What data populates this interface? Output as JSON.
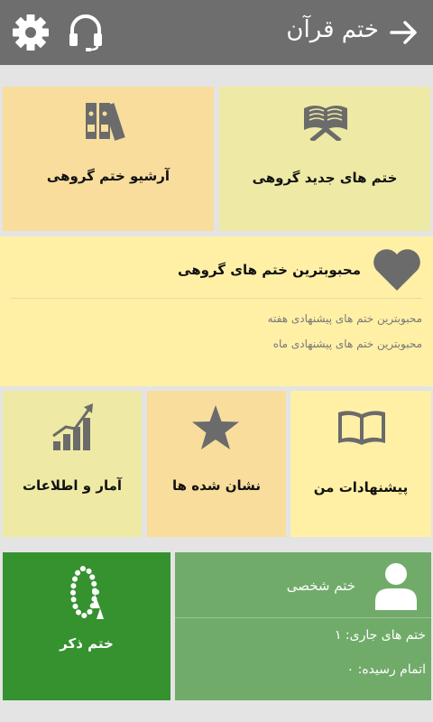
{
  "appbar": {
    "title": "ختم قرآن",
    "icons": [
      "arrow-right-icon",
      "headphones-icon",
      "gear-icon"
    ]
  },
  "tiles": {
    "new_group": "ختم های جدید گروهی",
    "archive": "آرشیو ختم گروهی",
    "favorites": {
      "title": "محبوبترین ختم های گروهی",
      "week": "محبوبترین ختم های پیشنهادی هفته",
      "month": "محبوبترین ختم های پیشنهادی ماه"
    },
    "my_suggestions": "پیشنهادات من",
    "bookmarked": "نشان شده ها",
    "stats": "آمار و اطلاعات",
    "personal": {
      "title": "ختم شخصی",
      "current_label": "ختم های جاری: ۱",
      "completed_label": "اتمام رسیده: ۰"
    },
    "zikr": "ختم ذکر"
  },
  "colors": {
    "appbar": "#6e6e6e",
    "tile_light_yellow": "#eeeaa5",
    "tile_orange": "#f8dd9d",
    "tile_pale": "#fff0a6",
    "tile_green_light": "#71ab6a",
    "tile_green_dark": "#35922f",
    "icon_grey": "#6b6b6b"
  }
}
